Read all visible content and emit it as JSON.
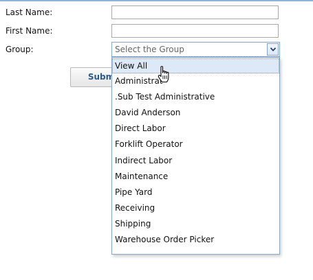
{
  "form": {
    "last_name_label": "Last Name:",
    "last_name_value": "",
    "first_name_label": "First Name:",
    "first_name_value": "",
    "group_label": "Group:",
    "group_placeholder": "Select the Group",
    "submit_label": "Subm"
  },
  "dropdown": {
    "options": [
      "View All",
      "Administrat",
      ".Sub Test Administrative",
      "David Anderson",
      "Direct Labor",
      "Forklift Operator",
      "Indirect Labor",
      "Maintenance",
      "Pipe Yard",
      "Receiving",
      "Shipping",
      "Warehouse Order Picker"
    ],
    "highlighted_option": "View All"
  },
  "icons": {
    "dropdown_arrow": "chevron-down-icon",
    "cursor": "hand-pointer-icon"
  },
  "colors": {
    "accent_border": "#8aa6c9",
    "highlight_bg": "#dde9f7",
    "button_text": "#2b5c8a"
  }
}
